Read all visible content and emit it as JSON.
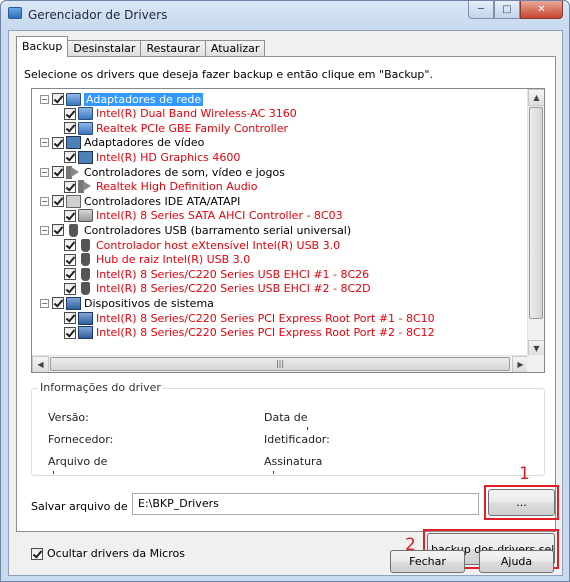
{
  "window": {
    "title": "Gerenciador de Drivers"
  },
  "tabs": [
    {
      "label": "Backup"
    },
    {
      "label": "Desinstalar"
    },
    {
      "label": "Restaurar"
    },
    {
      "label": "Atualizar"
    }
  ],
  "instruction": "Selecione os drivers que deseja fazer backup e então clique em \"Backup\".",
  "tree": [
    {
      "label": "Adaptadores de rede",
      "type": "category",
      "icon": "network-adapter-icon",
      "selected": true
    },
    {
      "label": "Intel(R) Dual Band Wireless-AC 3160",
      "type": "device",
      "icon": "network-adapter-icon"
    },
    {
      "label": "Realtek PCIe GBE Family Controller",
      "type": "device",
      "icon": "network-adapter-icon"
    },
    {
      "label": "Adaptadores de vídeo",
      "type": "category",
      "icon": "display-adapter-icon"
    },
    {
      "label": "Intel(R) HD Graphics 4600",
      "type": "device",
      "icon": "display-adapter-icon"
    },
    {
      "label": "Controladores de som, vídeo e jogos",
      "type": "category",
      "icon": "speaker-icon"
    },
    {
      "label": "Realtek High Definition Audio",
      "type": "device",
      "icon": "speaker-icon"
    },
    {
      "label": "Controladores IDE ATA/ATAPI",
      "type": "category",
      "icon": "ide-controller-icon"
    },
    {
      "label": "Intel(R) 8 Series SATA AHCI Controller - 8C03",
      "type": "device",
      "icon": "disk-controller-icon"
    },
    {
      "label": "Controladores USB (barramento serial universal)",
      "type": "category",
      "icon": "usb-icon"
    },
    {
      "label": "Controlador host eXtensível Intel(R) USB 3.0",
      "type": "device",
      "icon": "usb-icon"
    },
    {
      "label": "Hub de raiz Intel(R) USB 3.0",
      "type": "device",
      "icon": "usb-icon"
    },
    {
      "label": "Intel(R) 8 Series/C220 Series USB EHCI #1 - 8C26",
      "type": "device",
      "icon": "usb-icon"
    },
    {
      "label": "Intel(R) 8 Series/C220 Series USB EHCI #2 - 8C2D",
      "type": "device",
      "icon": "usb-icon"
    },
    {
      "label": "Dispositivos de sistema",
      "type": "category",
      "icon": "system-device-icon"
    },
    {
      "label": "Intel(R) 8 Series/C220 Series PCI Express Root Port #1 - 8C10",
      "type": "device",
      "icon": "system-device-icon"
    },
    {
      "label": "Intel(R) 8 Series/C220 Series PCI Express Root Port #2 - 8C12",
      "type": "device",
      "icon": "system-device-icon"
    }
  ],
  "driver_info": {
    "title": "Informações do driver",
    "version_label": "Versão:",
    "date_label": "Data de",
    "date_label_cut": "'",
    "vendor_label": "Fornecedor:",
    "id_label": "Idetificador:",
    "file_label": "Arquivo de",
    "file_label_cut": "'",
    "signature_label": "Assinatura",
    "signature_label_cut": "'"
  },
  "save": {
    "label": "Salvar arquivo de b...",
    "path": "E:\\BKP_Drivers",
    "browse_label": "..."
  },
  "hide_ms": {
    "label": "Ocultar drivers da Micros",
    "checked": true
  },
  "backup_button_label": "backup dos drivers selecionados",
  "markers": {
    "one": "1",
    "two": "2"
  },
  "footer": {
    "close_label": "Fechar",
    "help_label": "Ajuda"
  },
  "colors": {
    "device_text": "#e8000b",
    "highlight": "#e21f26",
    "selection": "#3399ff"
  }
}
